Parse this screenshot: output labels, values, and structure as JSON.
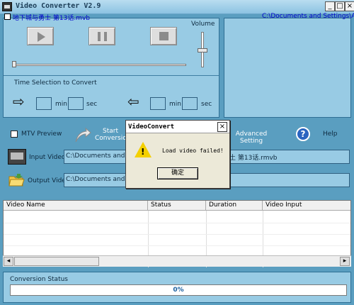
{
  "window": {
    "title": "Video Converter V2.9",
    "minimize": "_",
    "maximize": "□",
    "close": "×"
  },
  "player": {
    "volume_label": "Volume",
    "play_icon": "play-icon",
    "pause_icon": "pause-icon",
    "stop_icon": "stop-icon"
  },
  "time_selection": {
    "label": "Time Selection to Convert",
    "start_arrow": "⇨",
    "end_arrow": "⇦",
    "min": "min",
    "sec": "sec"
  },
  "options": {
    "mtv_preview": "MTV Preview",
    "start_line1": "Start",
    "start_line2": "Conversion",
    "advanced_line1": "Advanced",
    "advanced_line2": "Setting",
    "help": "Help"
  },
  "files": {
    "input_label": "Input Video",
    "input_value": "C:\\Documents and Se",
    "input_tail": "土 第13话.rmvb",
    "output_label": "Output Video",
    "output_value": "C:\\Documents and Se"
  },
  "table": {
    "headers": [
      "Video Name",
      "Status",
      "Duration",
      "Video Input"
    ],
    "rows": [
      {
        "name": "地下城与勇士 第13话.mvb",
        "status": "",
        "duration": "",
        "input": "C:\\Documents and Settings\\Adr"
      }
    ]
  },
  "status": {
    "label": "Conversion Status",
    "progress_text": "0%",
    "progress": 0
  },
  "dialog": {
    "title": "VideoConvert",
    "message": "Load video failed!",
    "ok": "确定",
    "close": "×"
  }
}
